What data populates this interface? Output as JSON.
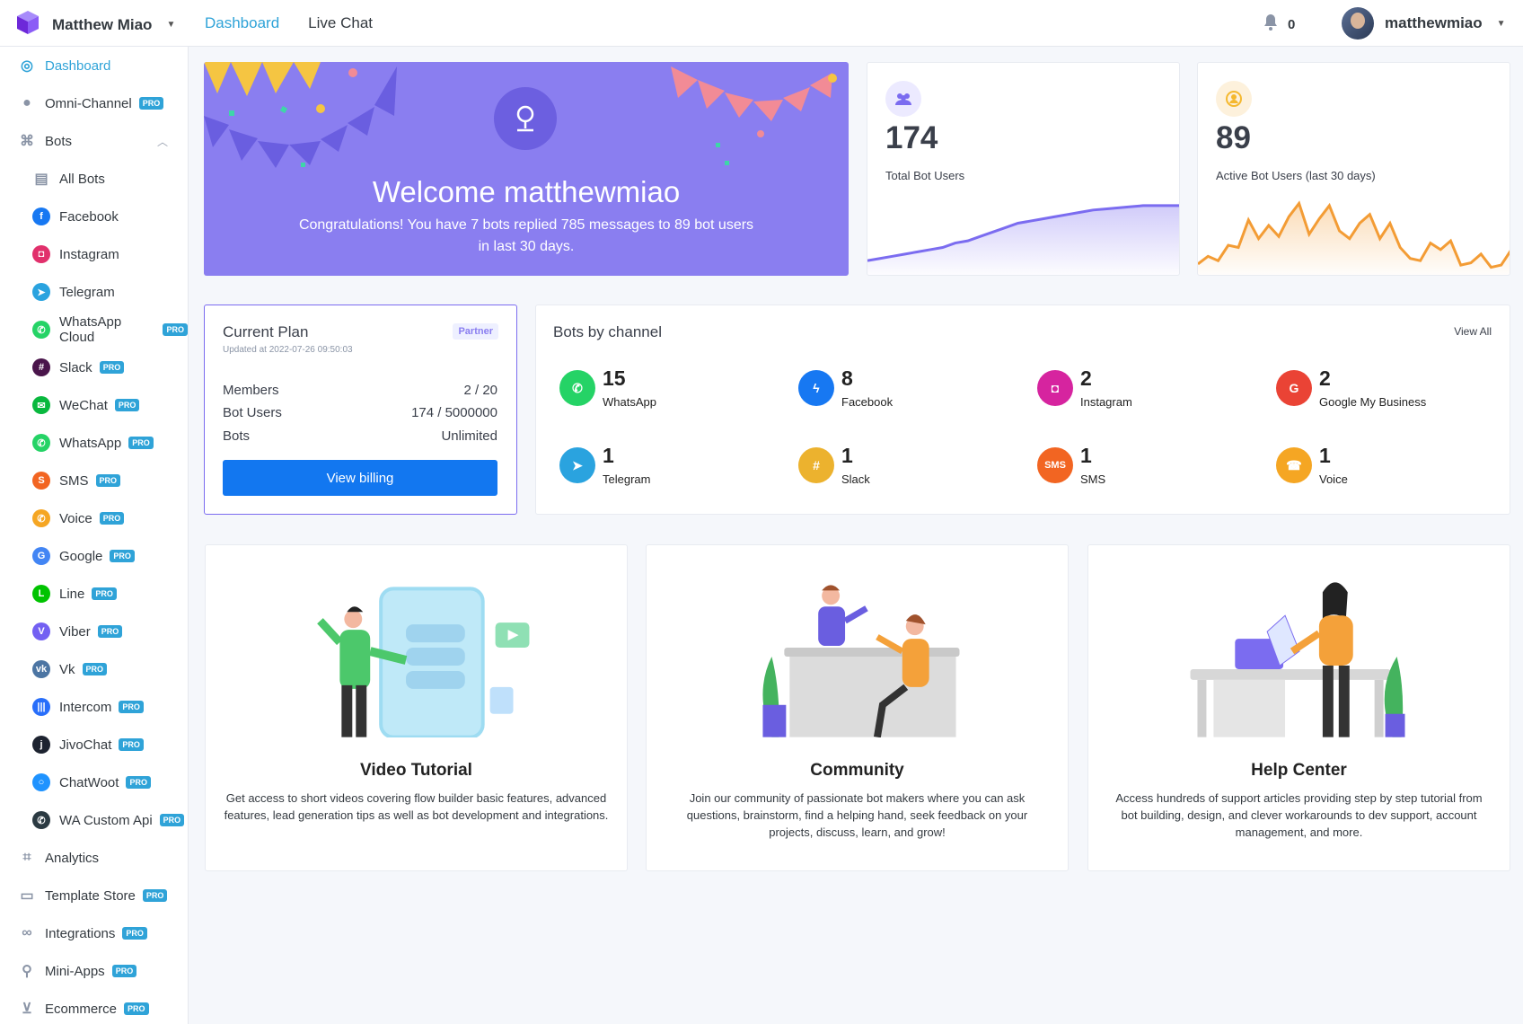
{
  "header": {
    "workspace": "Matthew Miao",
    "nav": [
      "Dashboard",
      "Live Chat"
    ],
    "notifications": "0",
    "username": "matthewmiao"
  },
  "sidebar": {
    "pro_label": "PRO",
    "items": [
      {
        "label": "Dashboard",
        "icon": "dashboard-icon"
      },
      {
        "label": "Omni-Channel",
        "icon": "omni-channel-icon",
        "pro": true
      },
      {
        "label": "Bots",
        "icon": "bots-icon"
      },
      {
        "label": "All Bots",
        "icon": "all-bots-icon"
      },
      {
        "label": "Facebook",
        "icon": "messenger-icon",
        "color": "#1778f2"
      },
      {
        "label": "Instagram",
        "icon": "instagram-icon",
        "color": "#e1306c"
      },
      {
        "label": "Telegram",
        "icon": "telegram-icon",
        "color": "#2aa3df"
      },
      {
        "label": "WhatsApp Cloud",
        "icon": "whatsapp-icon",
        "color": "#25d366",
        "pro": true
      },
      {
        "label": "Slack",
        "icon": "slack-icon",
        "color": "#4a154b",
        "pro": true
      },
      {
        "label": "WeChat",
        "icon": "wechat-icon",
        "color": "#09b83e",
        "pro": true
      },
      {
        "label": "WhatsApp",
        "icon": "whatsapp-icon",
        "color": "#25d366",
        "pro": true
      },
      {
        "label": "SMS",
        "icon": "sms-icon",
        "color": "#f26522",
        "pro": true
      },
      {
        "label": "Voice",
        "icon": "voice-icon",
        "color": "#f5a623",
        "pro": true
      },
      {
        "label": "Google",
        "icon": "google-icon",
        "color": "#4285f4",
        "pro": true
      },
      {
        "label": "Line",
        "icon": "line-icon",
        "color": "#00c300",
        "pro": true
      },
      {
        "label": "Viber",
        "icon": "viber-icon",
        "color": "#7360f2",
        "pro": true
      },
      {
        "label": "Vk",
        "icon": "vk-icon",
        "color": "#4c75a3",
        "pro": true
      },
      {
        "label": "Intercom",
        "icon": "intercom-icon",
        "color": "#286efa",
        "pro": true
      },
      {
        "label": "JivoChat",
        "icon": "jivochat-icon",
        "color": "#1d2330",
        "pro": true
      },
      {
        "label": "ChatWoot",
        "icon": "chatwoot-icon",
        "color": "#1f93ff",
        "pro": true
      },
      {
        "label": "WA Custom Api",
        "icon": "wa-custom-api-icon",
        "color": "#2b3a42",
        "pro": true
      },
      {
        "label": "Analytics",
        "icon": "analytics-icon"
      },
      {
        "label": "Template Store",
        "icon": "template-store-icon",
        "pro": true
      },
      {
        "label": "Integrations",
        "icon": "integrations-icon",
        "pro": true
      },
      {
        "label": "Mini-Apps",
        "icon": "mini-apps-icon",
        "pro": true
      },
      {
        "label": "Ecommerce",
        "icon": "ecommerce-icon",
        "pro": true
      }
    ]
  },
  "welcome": {
    "title": "Welcome matthewmiao",
    "message": "Congratulations! You have 7 bots replied 785 messages to 89 bot users in last 30 days."
  },
  "stats": [
    {
      "value": "174",
      "label": "Total Bot Users",
      "color": "#7b6cf0",
      "trend": [
        8,
        10,
        12,
        14,
        16,
        18,
        20,
        24,
        26,
        30,
        34,
        38,
        42,
        44,
        46,
        48,
        50,
        52,
        54,
        55,
        56,
        57,
        58,
        58,
        58,
        58
      ]
    },
    {
      "value": "89",
      "label": "Active Bot Users (last 30 days)",
      "color": "#f39c35",
      "trend": [
        5,
        12,
        8,
        22,
        20,
        45,
        28,
        40,
        30,
        48,
        60,
        32,
        46,
        58,
        35,
        28,
        42,
        50,
        28,
        42,
        20,
        10,
        8,
        24,
        18,
        26,
        4,
        6,
        14,
        2,
        4,
        18
      ]
    }
  ],
  "plan": {
    "title": "Current Plan",
    "badge": "Partner",
    "updated": "Updated at 2022-07-26 09:50:03",
    "rows": [
      {
        "label": "Members",
        "value": "2 / 20"
      },
      {
        "label": "Bot Users",
        "value": "174 / 5000000"
      },
      {
        "label": "Bots",
        "value": "Unlimited"
      }
    ],
    "button": "View billing"
  },
  "channels": {
    "title": "Bots by channel",
    "view_all": "View All",
    "items": [
      {
        "count": "15",
        "name": "WhatsApp",
        "icon": "whatsapp-icon",
        "color": "#25d366"
      },
      {
        "count": "8",
        "name": "Facebook",
        "icon": "messenger-icon",
        "color": "#1778f2"
      },
      {
        "count": "2",
        "name": "Instagram",
        "icon": "instagram-icon",
        "color": "#d6249f"
      },
      {
        "count": "2",
        "name": "Google My Business",
        "icon": "google-icon",
        "color": "#ea4335"
      },
      {
        "count": "1",
        "name": "Telegram",
        "icon": "telegram-icon",
        "color": "#2aa3df"
      },
      {
        "count": "1",
        "name": "Slack",
        "icon": "slack-icon",
        "color": "#ecb22e"
      },
      {
        "count": "1",
        "name": "SMS",
        "icon": "sms-icon",
        "color": "#f26522",
        "text": "SMS"
      },
      {
        "count": "1",
        "name": "Voice",
        "icon": "voice-icon",
        "color": "#f5a623"
      }
    ]
  },
  "resources": [
    {
      "title": "Video Tutorial",
      "description": "Get access to short videos covering flow builder basic features, advanced features, lead generation tips as well as bot development and integrations.",
      "art": "video-tutorial-illustration"
    },
    {
      "title": "Community",
      "description": "Join our community of passionate bot makers where you can ask questions, brainstorm, find a helping hand, seek feedback on your projects, discuss, learn, and grow!",
      "art": "community-illustration"
    },
    {
      "title": "Help Center",
      "description": "Access hundreds of support articles providing step by step tutorial from bot building, design, and clever workarounds to dev support, account management, and more.",
      "art": "help-center-illustration"
    }
  ]
}
